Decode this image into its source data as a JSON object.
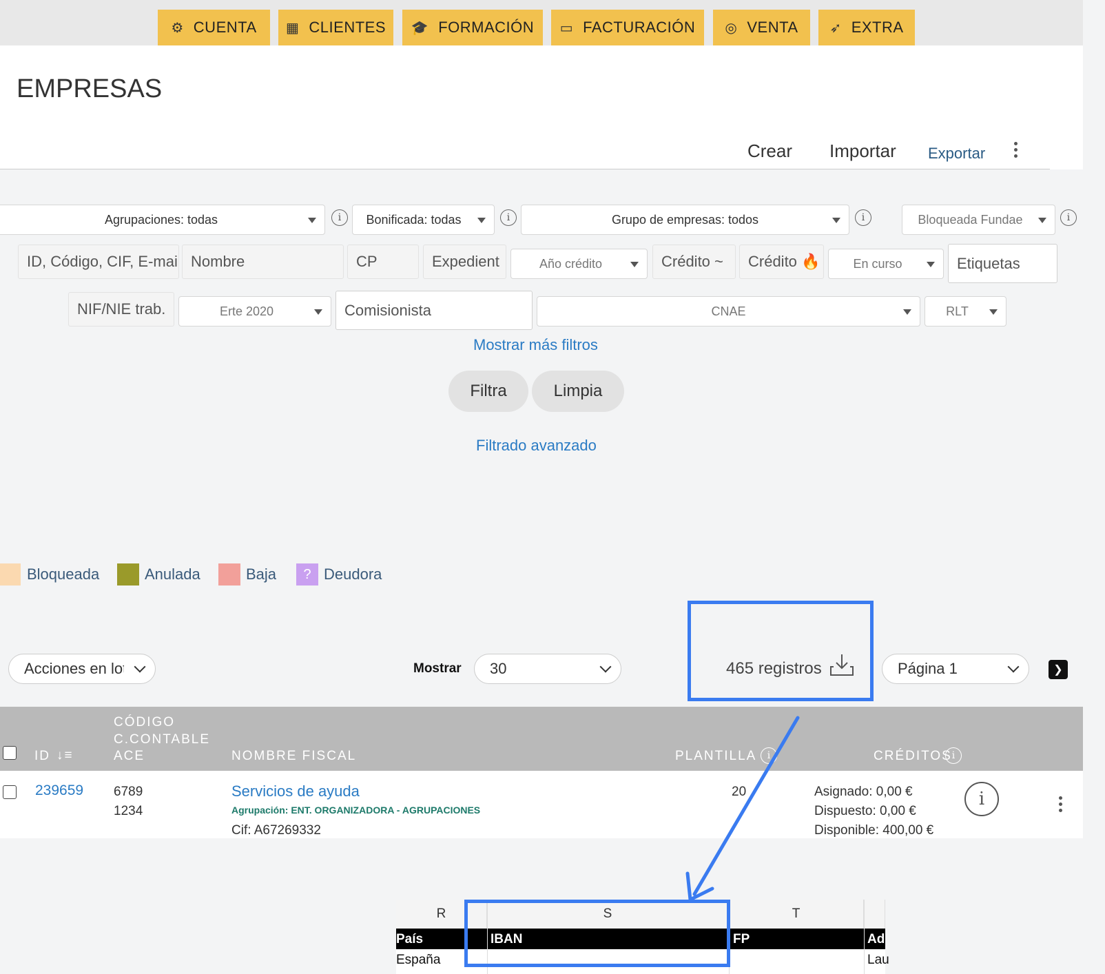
{
  "nav": {
    "items": [
      {
        "label": "CUENTA",
        "icon": "gears-icon"
      },
      {
        "label": "CLIENTES",
        "icon": "building-icon"
      },
      {
        "label": "FORMACIÓN",
        "icon": "graduation-cap-icon"
      },
      {
        "label": "FACTURACIÓN",
        "icon": "money-bill-icon"
      },
      {
        "label": "VENTA",
        "icon": "target-icon"
      },
      {
        "label": "EXTRA",
        "icon": "rocket-icon"
      }
    ],
    "color": "#f2c14e"
  },
  "page": {
    "title": "EMPRESAS",
    "actions": {
      "crear": "Crear",
      "importar": "Importar",
      "exportar": "Exportar"
    }
  },
  "filters": {
    "agrupaciones": "Agrupaciones: todas",
    "bonificada": "Bonificada: todas",
    "grupo": "Grupo de empresas: todos",
    "bloqueada": "Bloqueada Fundae",
    "id_placeholder": "ID, Código, CIF, E-mail",
    "nombre": "Nombre",
    "cp": "CP",
    "expediente": "Expedient",
    "anio_credito": "Año crédito",
    "credito_tilde": "Crédito ~",
    "credito_fire": "Crédito 🔥",
    "en_curso": "En curso",
    "etiquetas": "Etiquetas",
    "nif": "NIF/NIE trab.",
    "erte": "Erte 2020",
    "comisionista": "Comisionista",
    "cnae": "CNAE",
    "rlt": "RLT",
    "mas_filtros": "Mostrar más filtros",
    "filtra": "Filtra",
    "limpia": "Limpia",
    "avanzado": "Filtrado avanzado"
  },
  "legend": [
    {
      "label": "Bloqueada",
      "color": "#fbd9b0"
    },
    {
      "label": "Anulada",
      "color": "#9a9a2a"
    },
    {
      "label": "Baja",
      "color": "#f2a09a"
    },
    {
      "label": "Deudora",
      "color": "#c9a0f0",
      "mark": "?"
    }
  ],
  "toolbar": {
    "acciones": "Acciones en lote",
    "mostrar_label": "Mostrar",
    "mostrar_value": "30",
    "registros": "465 registros",
    "pagina": "Página 1"
  },
  "table": {
    "headers": {
      "id": "ID",
      "codigo1": "CÓDIGO",
      "codigo2": "C.CONTABLE",
      "codigo3": "ACE",
      "nombre": "NOMBRE FISCAL",
      "plantilla": "PLANTILLA",
      "creditos": "CRÉDITOS"
    },
    "rows": [
      {
        "id": "239659",
        "codigo": "6789",
        "contable": "1234",
        "nombre": "Servicios de ayuda",
        "agrupacion": "Agrupación: ENT. ORGANIZADORA - AGRUPACIONES",
        "cif": "Cif: A67269332",
        "plantilla": "20",
        "asignado": "Asignado: 0,00 €",
        "dispuesto": "Dispuesto: 0,00 €",
        "disponible": "Disponible: 400,00 €"
      }
    ]
  },
  "spreadsheet": {
    "columns": [
      "R",
      "S",
      "T"
    ],
    "headers": [
      "País",
      "IBAN",
      "FP",
      "Ad"
    ],
    "row": [
      "España",
      "",
      "",
      "Lau"
    ]
  },
  "highlight_color": "#3a7bf0"
}
